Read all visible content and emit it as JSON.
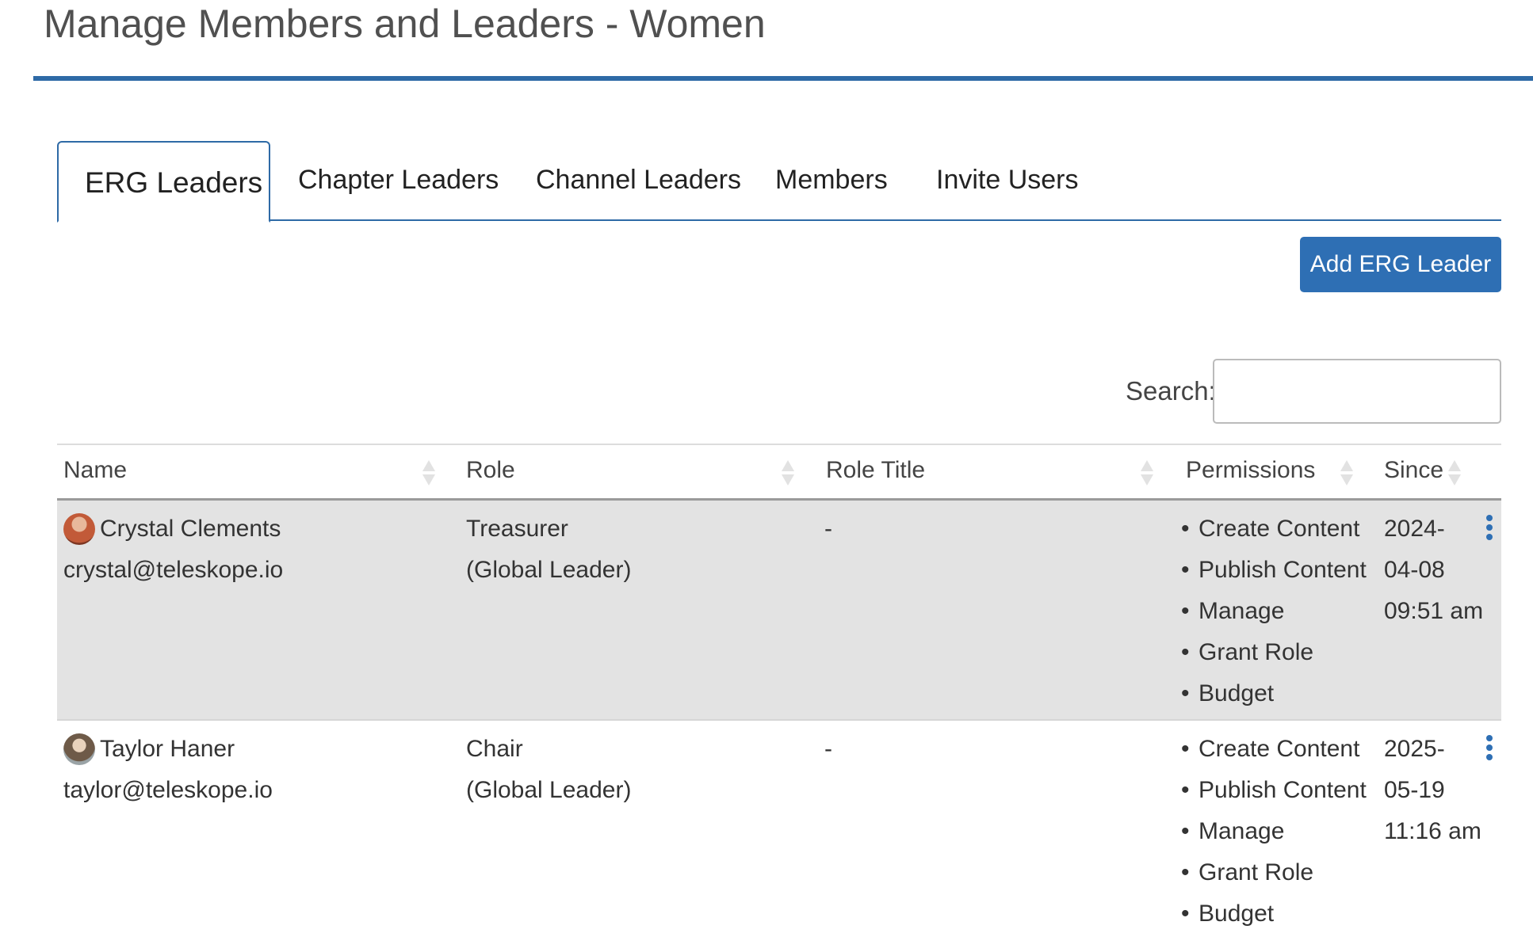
{
  "page": {
    "title": "Manage Members and Leaders - Women"
  },
  "tabs": [
    {
      "label": "ERG Leaders",
      "active": true
    },
    {
      "label": "Chapter Leaders",
      "active": false
    },
    {
      "label": "Channel Leaders",
      "active": false
    },
    {
      "label": "Members",
      "active": false
    },
    {
      "label": "Invite Users",
      "active": false
    }
  ],
  "actions": {
    "add_label": "Add ERG Leader"
  },
  "search": {
    "label": "Search:",
    "value": ""
  },
  "table": {
    "columns": [
      "Name",
      "Role",
      "Role Title",
      "Permissions",
      "Since"
    ],
    "rows": [
      {
        "name": "Crystal Clements",
        "email": "crystal@teleskope.io",
        "role": "Treasurer",
        "role_scope": "(Global Leader)",
        "role_title": "-",
        "permissions": [
          "Create Content",
          "Publish Content",
          "Manage",
          "Grant Role",
          "Budget"
        ],
        "since": [
          "2024-",
          "04-08",
          "09:51 am"
        ]
      },
      {
        "name": "Taylor Haner",
        "email": "taylor@teleskope.io",
        "role": "Chair",
        "role_scope": "(Global Leader)",
        "role_title": "-",
        "permissions": [
          "Create Content",
          "Publish Content",
          "Manage",
          "Grant Role",
          "Budget"
        ],
        "since": [
          "2025-",
          "05-19",
          "11:16 am"
        ]
      }
    ]
  },
  "colors": {
    "accent": "#2e6aa6",
    "button": "#2e6fb4",
    "highlight_row": "#e3e3e3"
  },
  "icons": {
    "sort": "sort-arrows-icon",
    "row_menu": "kebab-menu-icon",
    "avatar": "user-avatar"
  }
}
